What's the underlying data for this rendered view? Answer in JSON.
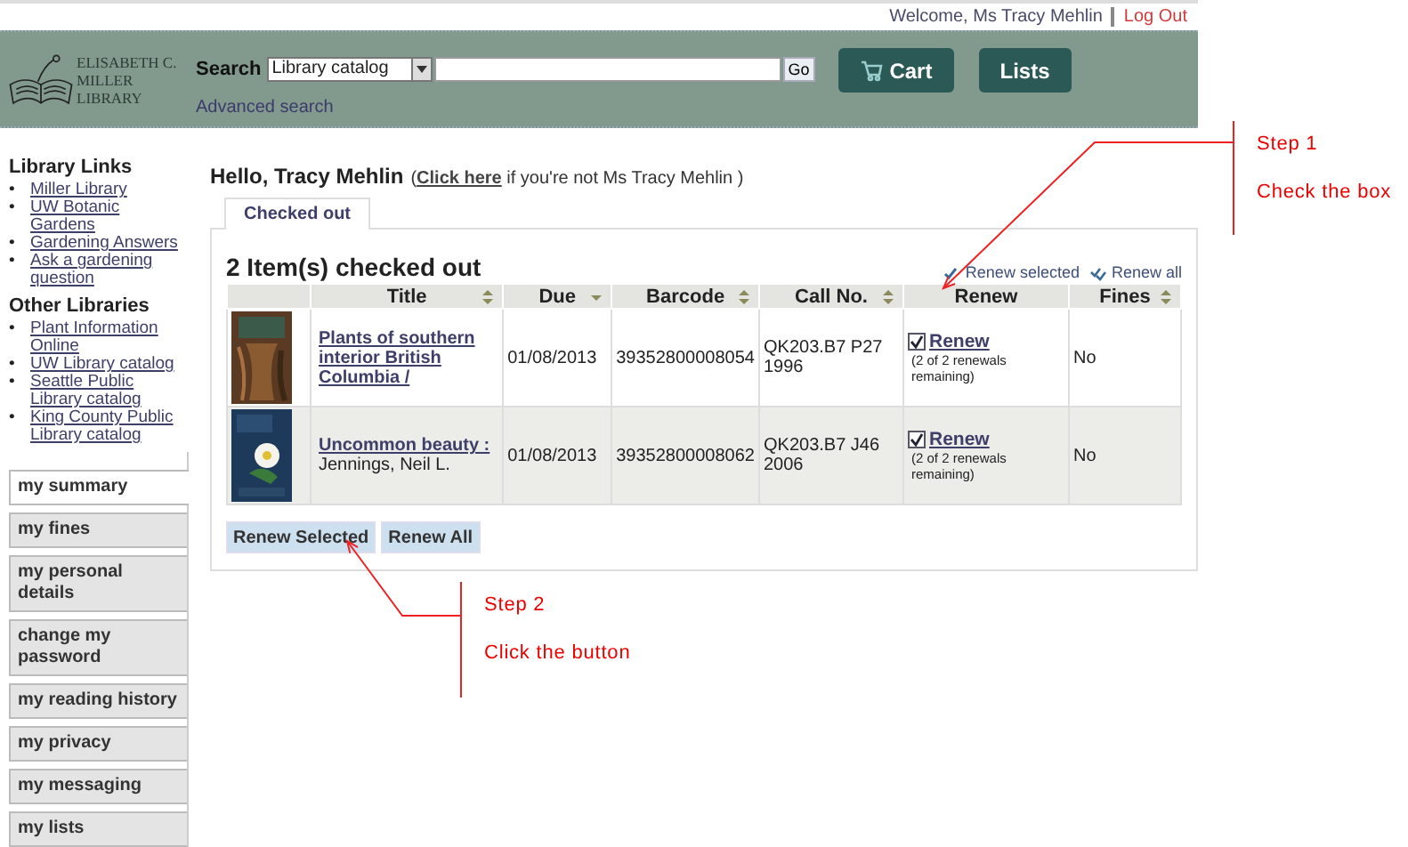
{
  "top_bar": {
    "welcome": "Welcome, Ms Tracy Mehlin",
    "logout": "Log Out"
  },
  "header": {
    "logo_lines": [
      "ELISABETH C.",
      "MILLER",
      "LIBRARY"
    ],
    "search_label": "Search",
    "search_scope": "Library catalog",
    "go_button": "Go",
    "advanced_search": "Advanced search",
    "buttons": [
      {
        "label": "Cart",
        "kind": "cart"
      },
      {
        "label": "Lists",
        "kind": "lists"
      }
    ]
  },
  "sidebar": {
    "sections": [
      {
        "heading": "Library Links",
        "bullet": "•",
        "links": [
          "Miller Library",
          "UW Botanic Gardens",
          "Gardening Answers",
          "Ask a gardening question"
        ]
      },
      {
        "heading": "Other Libraries",
        "bullet": "•",
        "links": [
          "Plant Information Online",
          "UW Library catalog",
          "Seattle Public Library catalog",
          "King County Public Library catalog"
        ]
      }
    ],
    "nav": [
      {
        "label": "my summary",
        "selected": true
      },
      {
        "label": "my fines",
        "selected": false
      },
      {
        "label": "my personal details",
        "selected": false
      },
      {
        "label": "change my password",
        "selected": false
      },
      {
        "label": "my reading history",
        "selected": false
      },
      {
        "label": "my privacy",
        "selected": false
      },
      {
        "label": "my messaging",
        "selected": false
      },
      {
        "label": "my lists",
        "selected": false
      }
    ]
  },
  "main": {
    "greeting": "Hello, Tracy Mehlin",
    "note_before": "(",
    "note_link": "Click here",
    "note_after": " if you're not Ms Tracy Mehlin )",
    "tabs": [
      {
        "label": "Checked out",
        "selected": true
      }
    ],
    "heading": "2 Item(s) checked out",
    "actions": [
      {
        "label": "Renew selected",
        "kind": "check"
      },
      {
        "label": "Renew all",
        "kind": "double"
      }
    ],
    "table": {
      "columns": [
        {
          "kind": "blank"
        },
        {
          "label": "Title",
          "kind": "sortable"
        },
        {
          "label": "Due",
          "kind": "sorted"
        },
        {
          "label": "Barcode",
          "kind": "sortable"
        },
        {
          "label": "Call No.",
          "kind": "sortable"
        },
        {
          "label": "Renew",
          "kind": "plain"
        },
        {
          "label": "Fines",
          "kind": "sortable"
        }
      ],
      "rows": [
        {
          "title": "Plants of southern interior British Columbia /",
          "due": "01/08/2013",
          "barcode": "39352800008054",
          "call_no": "QK203.B7 P27 1996",
          "renew": {
            "checked": true,
            "label": "Renew",
            "note": "(2 of 2 renewals remaining)"
          },
          "fines": "No"
        },
        {
          "title": "Uncommon beauty :",
          "author": " Jennings, Neil L.",
          "due": "01/08/2013",
          "barcode": "39352800008062",
          "call_no": "QK203.B7 J46 2006",
          "renew": {
            "checked": true,
            "label": "Renew",
            "note": "(2 of 2 renewals remaining)"
          },
          "fines": "No"
        }
      ]
    },
    "buttons": [
      "Renew Selected",
      "Renew All"
    ]
  },
  "annotations": [
    {
      "step": "Step 1",
      "instruction": "Check the box"
    },
    {
      "step": "Step 2",
      "instruction": "Click the button"
    }
  ]
}
